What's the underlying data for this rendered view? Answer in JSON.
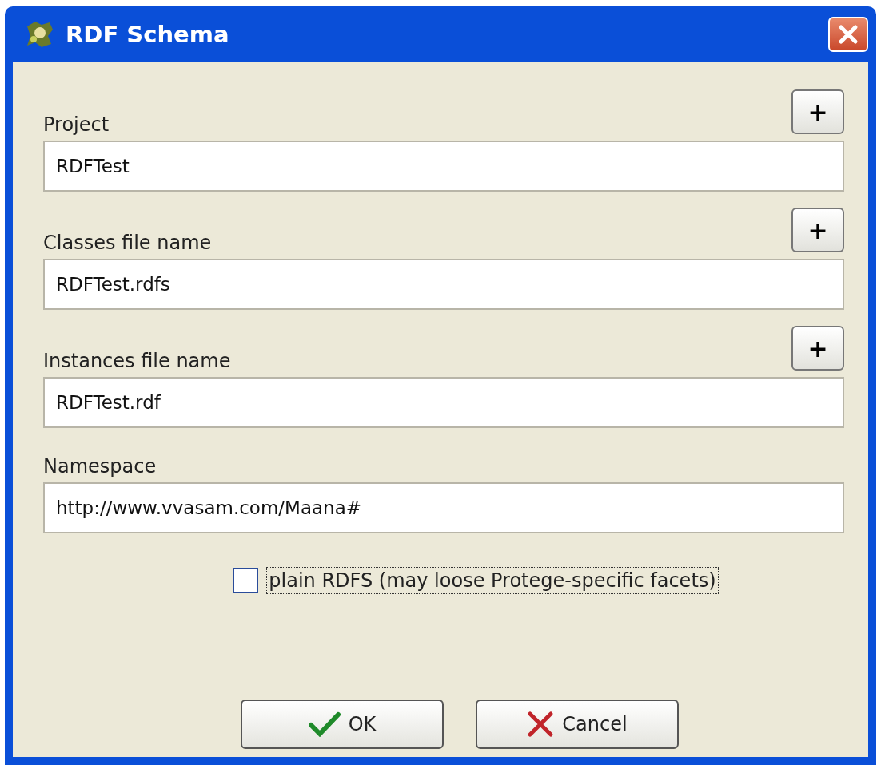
{
  "window": {
    "title": "RDF Schema"
  },
  "fields": [
    {
      "label": "Project",
      "value": "RDFTest",
      "add_button": "+"
    },
    {
      "label": "Classes file name",
      "value": "RDFTest.rdfs",
      "add_button": "+"
    },
    {
      "label": "Instances file name",
      "value": "RDFTest.rdf",
      "add_button": "+"
    },
    {
      "label": "Namespace",
      "value": "http://www.vvasam.com/Maana#"
    }
  ],
  "option": {
    "label": "plain RDFS (may loose Protege-specific facets)",
    "checked": false
  },
  "buttons": [
    {
      "label": "OK",
      "kind": "ok"
    },
    {
      "label": "Cancel",
      "kind": "cancel"
    }
  ]
}
